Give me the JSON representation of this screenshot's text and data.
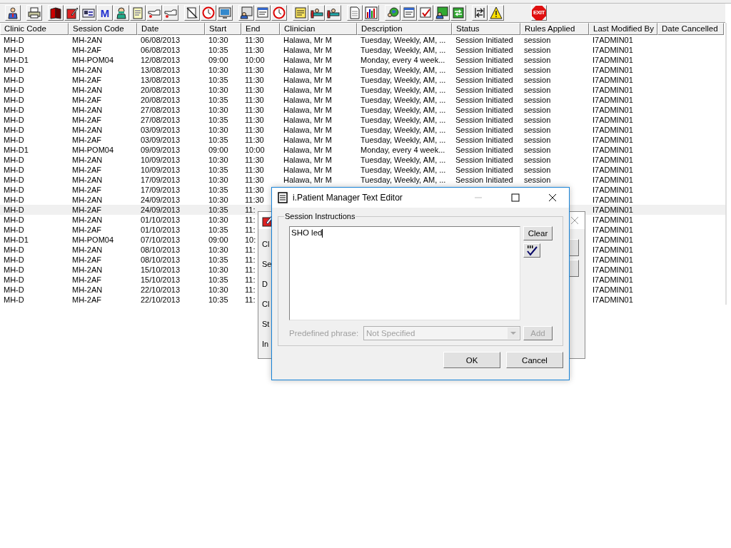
{
  "toolbar": {
    "m_label": "M",
    "exit_label": "EXIT"
  },
  "table": {
    "columns": [
      "Clinic Code",
      "Session Code",
      "Date",
      "Start",
      "End",
      "Clinician",
      "Description",
      "Status",
      "Rules Applied",
      "Last Modified By",
      "Date Cancelled"
    ],
    "rows": [
      {
        "clinic": "MH-D",
        "session": "MH-2AN",
        "date": "06/08/2013",
        "start": "10:30",
        "end": "11:30",
        "clinician": "Halawa, Mr M",
        "description": "Tuesday, Weekly, AM, ...",
        "status": "Session Initiated",
        "rules": "session",
        "modified": "I7ADMIN01",
        "selected": false
      },
      {
        "clinic": "MH-D",
        "session": "MH-2AF",
        "date": "06/08/2013",
        "start": "10:35",
        "end": "11:30",
        "clinician": "Halawa, Mr M",
        "description": "Tuesday, Weekly, AM, ...",
        "status": "Session Initiated",
        "rules": "session",
        "modified": "I7ADMIN01",
        "selected": false
      },
      {
        "clinic": "MH-D1",
        "session": "MH-POM04",
        "date": "12/08/2013",
        "start": "09:00",
        "end": "10:00",
        "clinician": "Halawa, Mr M",
        "description": "Monday, every 4 week...",
        "status": "Session Initiated",
        "rules": "session",
        "modified": "I7ADMIN01",
        "selected": false
      },
      {
        "clinic": "MH-D",
        "session": "MH-2AN",
        "date": "13/08/2013",
        "start": "10:30",
        "end": "11:30",
        "clinician": "Halawa, Mr M",
        "description": "Tuesday, Weekly, AM, ...",
        "status": "Session Initiated",
        "rules": "session",
        "modified": "I7ADMIN01",
        "selected": false
      },
      {
        "clinic": "MH-D",
        "session": "MH-2AF",
        "date": "13/08/2013",
        "start": "10:35",
        "end": "11:30",
        "clinician": "Halawa, Mr M",
        "description": "Tuesday, Weekly, AM, ...",
        "status": "Session Initiated",
        "rules": "session",
        "modified": "I7ADMIN01",
        "selected": false
      },
      {
        "clinic": "MH-D",
        "session": "MH-2AN",
        "date": "20/08/2013",
        "start": "10:30",
        "end": "11:30",
        "clinician": "Halawa, Mr M",
        "description": "Tuesday, Weekly, AM, ...",
        "status": "Session Initiated",
        "rules": "session",
        "modified": "I7ADMIN01",
        "selected": false
      },
      {
        "clinic": "MH-D",
        "session": "MH-2AF",
        "date": "20/08/2013",
        "start": "10:35",
        "end": "11:30",
        "clinician": "Halawa, Mr M",
        "description": "Tuesday, Weekly, AM, ...",
        "status": "Session Initiated",
        "rules": "session",
        "modified": "I7ADMIN01",
        "selected": false
      },
      {
        "clinic": "MH-D",
        "session": "MH-2AN",
        "date": "27/08/2013",
        "start": "10:30",
        "end": "11:30",
        "clinician": "Halawa, Mr M",
        "description": "Tuesday, Weekly, AM, ...",
        "status": "Session Initiated",
        "rules": "session",
        "modified": "I7ADMIN01",
        "selected": false
      },
      {
        "clinic": "MH-D",
        "session": "MH-2AF",
        "date": "27/08/2013",
        "start": "10:35",
        "end": "11:30",
        "clinician": "Halawa, Mr M",
        "description": "Tuesday, Weekly, AM, ...",
        "status": "Session Initiated",
        "rules": "session",
        "modified": "I7ADMIN01",
        "selected": false
      },
      {
        "clinic": "MH-D",
        "session": "MH-2AN",
        "date": "03/09/2013",
        "start": "10:30",
        "end": "11:30",
        "clinician": "Halawa, Mr M",
        "description": "Tuesday, Weekly, AM, ...",
        "status": "Session Initiated",
        "rules": "session",
        "modified": "I7ADMIN01",
        "selected": false
      },
      {
        "clinic": "MH-D",
        "session": "MH-2AF",
        "date": "03/09/2013",
        "start": "10:35",
        "end": "11:30",
        "clinician": "Halawa, Mr M",
        "description": "Tuesday, Weekly, AM, ...",
        "status": "Session Initiated",
        "rules": "session",
        "modified": "I7ADMIN01",
        "selected": false
      },
      {
        "clinic": "MH-D1",
        "session": "MH-POM04",
        "date": "09/09/2013",
        "start": "09:00",
        "end": "10:00",
        "clinician": "Halawa, Mr M",
        "description": "Monday, every 4 week...",
        "status": "Session Initiated",
        "rules": "session",
        "modified": "I7ADMIN01",
        "selected": false
      },
      {
        "clinic": "MH-D",
        "session": "MH-2AN",
        "date": "10/09/2013",
        "start": "10:30",
        "end": "11:30",
        "clinician": "Halawa, Mr M",
        "description": "Tuesday, Weekly, AM, ...",
        "status": "Session Initiated",
        "rules": "session",
        "modified": "I7ADMIN01",
        "selected": false
      },
      {
        "clinic": "MH-D",
        "session": "MH-2AF",
        "date": "10/09/2013",
        "start": "10:35",
        "end": "11:30",
        "clinician": "Halawa, Mr M",
        "description": "Tuesday, Weekly, AM, ...",
        "status": "Session Initiated",
        "rules": "session",
        "modified": "I7ADMIN01",
        "selected": false
      },
      {
        "clinic": "MH-D",
        "session": "MH-2AN",
        "date": "17/09/2013",
        "start": "10:30",
        "end": "11:30",
        "clinician": "Halawa, Mr M",
        "description": "Tuesday, Weekly, AM, ...",
        "status": "Session Initiated",
        "rules": "session",
        "modified": "I7ADMIN01",
        "selected": false
      },
      {
        "clinic": "MH-D",
        "session": "MH-2AF",
        "date": "17/09/2013",
        "start": "10:35",
        "end": "11:30",
        "modified": "I7ADMIN01",
        "selected": false
      },
      {
        "clinic": "MH-D",
        "session": "MH-2AN",
        "date": "24/09/2013",
        "start": "10:30",
        "end": "11:30",
        "modified": "I7ADMIN01",
        "selected": false
      },
      {
        "clinic": "MH-D",
        "session": "MH-2AF",
        "date": "24/09/2013",
        "start": "10:35",
        "end": "11:",
        "modified": "I7ADMIN01",
        "selected": true
      },
      {
        "clinic": "MH-D",
        "session": "MH-2AN",
        "date": "01/10/2013",
        "start": "10:30",
        "end": "11:",
        "modified": "I7ADMIN01",
        "selected": false
      },
      {
        "clinic": "MH-D",
        "session": "MH-2AF",
        "date": "01/10/2013",
        "start": "10:35",
        "end": "11:",
        "modified": "I7ADMIN01",
        "selected": false
      },
      {
        "clinic": "MH-D1",
        "session": "MH-POM04",
        "date": "07/10/2013",
        "start": "09:00",
        "end": "10:",
        "modified": "I7ADMIN01",
        "selected": false
      },
      {
        "clinic": "MH-D",
        "session": "MH-2AN",
        "date": "08/10/2013",
        "start": "10:30",
        "end": "11:",
        "modified": "I7ADMIN01",
        "selected": false
      },
      {
        "clinic": "MH-D",
        "session": "MH-2AF",
        "date": "08/10/2013",
        "start": "10:35",
        "end": "11:",
        "modified": "I7ADMIN01",
        "selected": false
      },
      {
        "clinic": "MH-D",
        "session": "MH-2AN",
        "date": "15/10/2013",
        "start": "10:30",
        "end": "11:",
        "modified": "I7ADMIN01",
        "selected": false
      },
      {
        "clinic": "MH-D",
        "session": "MH-2AF",
        "date": "15/10/2013",
        "start": "10:35",
        "end": "11:",
        "modified": "I7ADMIN01",
        "selected": false
      },
      {
        "clinic": "MH-D",
        "session": "MH-2AN",
        "date": "22/10/2013",
        "start": "10:30",
        "end": "11:",
        "modified": "I7ADMIN01",
        "selected": false
      },
      {
        "clinic": "MH-D",
        "session": "MH-2AF",
        "date": "22/10/2013",
        "start": "10:35",
        "end": "11:",
        "modified": "I7ADMIN01",
        "selected": false
      }
    ]
  },
  "back_dialog": {
    "labels": [
      "Cl",
      "Se",
      "D",
      "Cl",
      "St",
      "In"
    ]
  },
  "text_editor": {
    "title": "i.Patient Manager Text Editor",
    "group_label": "Session Instructions",
    "text": "SHO led",
    "clear_button": "Clear",
    "phrase_label": "Predefined phrase:",
    "phrase_value": "Not Specified",
    "phrase_disabled": true,
    "add_button": "Add",
    "ok_button": "OK",
    "cancel_button": "Cancel"
  }
}
